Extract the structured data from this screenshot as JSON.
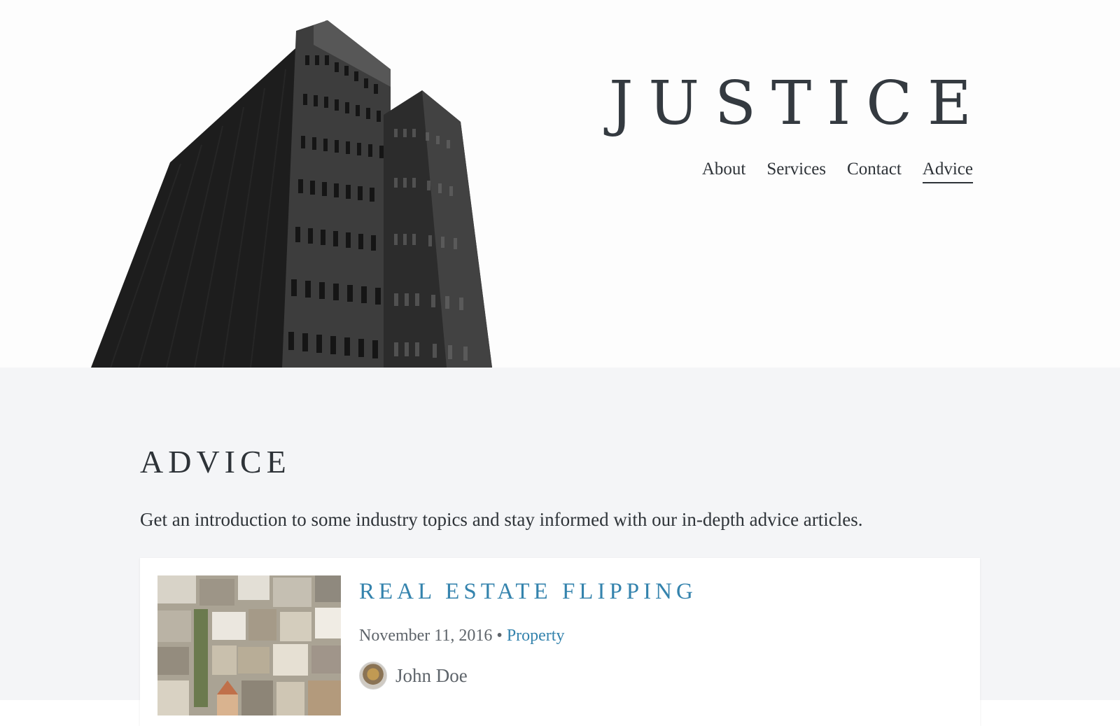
{
  "site": {
    "brand": "JUSTICE"
  },
  "nav": {
    "items": [
      {
        "label": "About",
        "active": false
      },
      {
        "label": "Services",
        "active": false
      },
      {
        "label": "Contact",
        "active": false
      },
      {
        "label": "Advice",
        "active": true
      }
    ]
  },
  "page": {
    "heading": "ADVICE",
    "intro": "Get an introduction to some industry topics and stay informed with our in-depth advice articles."
  },
  "articles": [
    {
      "title": "REAL ESTATE FLIPPING",
      "date": "November 11, 2016",
      "separator": " • ",
      "category": "Property",
      "author": "John Doe"
    }
  ],
  "colors": {
    "link": "#3483ad",
    "text": "#2e3338",
    "muted": "#5e646a",
    "main_bg": "#f4f5f7"
  }
}
